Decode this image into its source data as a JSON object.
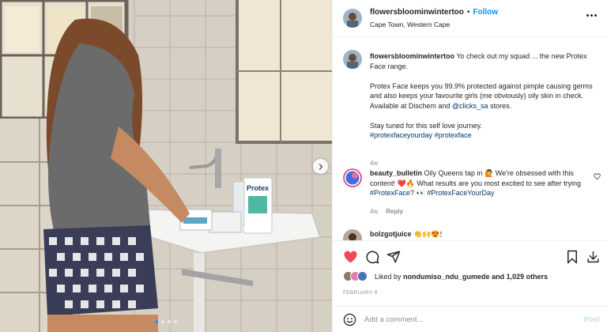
{
  "post": {
    "username": "flowersbloominwintertoo",
    "bullet": "•",
    "follow_label": "Follow",
    "location": "Cape Town, Western Cape",
    "carousel_count": 4,
    "carousel_active": 1,
    "product_label": "Protex"
  },
  "caption": {
    "username": "flowersbloominwintertoo",
    "line1": "Yo check out my squad ... the new Protex Face range.",
    "para2_a": "Protex Face keeps you 99.9% protected against pimple causing germs and also keeps your favourite girls (me obviously) oily skin in check. Available at Dischem and ",
    "para2_mention": "@clicks_sa",
    "para2_b": " stores.",
    "para3": "Stay tuned for this self love journey.",
    "hashtag1": "#protexfaceyourday",
    "hashtag2": "#protexface",
    "time": "4w"
  },
  "comments": [
    {
      "username": "beauty_bulletin",
      "text_a": "Oily Queens tap in 🙋 We're obsessed with this content! ❤️🔥 What results are you most excited to see after trying ",
      "hashtag1": "#ProtexFace",
      "mid": "? 👀 ",
      "hashtag2": "#ProtexFaceYourDay",
      "time": "4w",
      "reply_label": "Reply"
    },
    {
      "username": "bolzgotjuice",
      "text": "👏🙌😍🕯"
    }
  ],
  "likes": {
    "prefix": "Liked by",
    "user": "nondumiso_ndu_gumede",
    "suffix": "and 1,029 others"
  },
  "date": "FEBRUARY 8",
  "add_comment": {
    "placeholder": "Add a comment...",
    "post_label": "Post"
  },
  "icons": [
    "next-arrow-icon",
    "more-icon",
    "heart-icon",
    "comment-icon",
    "share-icon",
    "save-icon",
    "download-icon",
    "emoji-icon"
  ],
  "colors": {
    "follow": "#0095f6",
    "link": "#00376b",
    "muted": "#8e8e8e",
    "like_red": "#ed4956",
    "post_disabled": "#b2dffc"
  }
}
